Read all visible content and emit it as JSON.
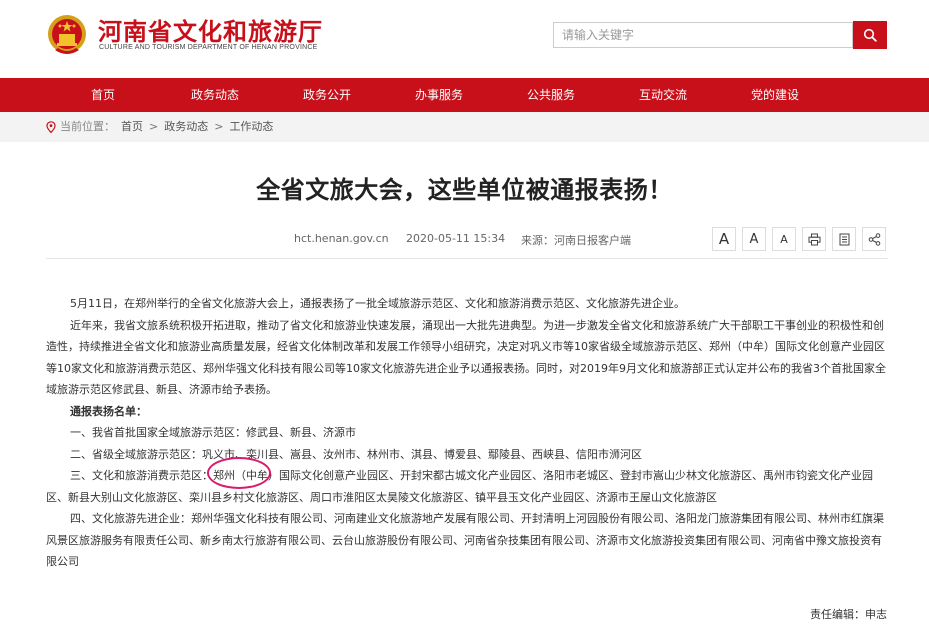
{
  "header": {
    "site_title": "河南省文化和旅游厅",
    "site_subtitle": "CULTURE AND TOURISM DEPARTMENT OF HENAN PROVINCE",
    "search_placeholder": "请输入关键字"
  },
  "nav": {
    "items": [
      "首页",
      "政务动态",
      "政务公开",
      "办事服务",
      "公共服务",
      "互动交流",
      "党的建设"
    ]
  },
  "breadcrumb": {
    "label": "当前位置：",
    "items": [
      "首页",
      "政务动态",
      "工作动态"
    ],
    "separator": ">"
  },
  "article": {
    "title": "全省文旅大会，这些单位被通报表扬！",
    "site": "hct.henan.gov.cn",
    "datetime": "2020-05-11 15:34",
    "source": "来源：河南日报客户端",
    "tools": {
      "font_large": "A",
      "font_medium": "A",
      "font_small": "A"
    },
    "paragraphs": [
      "5月11日，在郑州举行的全省文化旅游大会上，通报表扬了一批全域旅游示范区、文化和旅游消费示范区、文化旅游先进企业。",
      "近年来，我省文旅系统积极开拓进取，推动了省文化和旅游业快速发展，涌现出一大批先进典型。为进一步激发全省文化和旅游系统广大干部职工干事创业的积极性和创造性，持续推进全省文化和旅游业高质量发展，经省文化体制改革和发展工作领导小组研究，决定对巩义市等10家省级全域旅游示范区、郑州（中牟）国际文化创意产业园区等10家文化和旅游消费示范区、郑州华强文化科技有限公司等10家文化旅游先进企业予以通报表扬。同时，对2019年9月文化和旅游部正式认定并公布的我省3个首批国家全域旅游示范区修武县、新县、济源市给予表扬。",
      "通报表扬名单：",
      "一、我省首批国家全域旅游示范区：修武县、新县、济源市",
      "二、省级全域旅游示范区：巩义市、栾川县、嵩县、汝州市、林州市、淇县、博爱县、鄢陵县、西峡县、信阳市浉河区",
      "三、文化和旅游消费示范区：郑州（中牟）国际文化创意产业园区、开封宋都古城文化产业园区、洛阳市老城区、登封市嵩山少林文化旅游区、禹州市钧瓷文化产业园区、新县大别山文化旅游区、栾川县乡村文化旅游区、周口市淮阳区太昊陵文化旅游区、镇平县玉文化产业园区、济源市王屋山文化旅游区",
      "四、文化旅游先进企业：郑州华强文化科技有限公司、河南建业文化旅游地产发展有限公司、开封清明上河园股份有限公司、洛阳龙门旅游集团有限公司、林州市红旗渠风景区旅游服务有限责任公司、新乡南太行旅游有限公司、云台山旅游股份有限公司、河南省杂技集团有限公司、济源市文化旅游投资集团有限公司、河南省中豫文旅投资有限公司"
    ],
    "editor": "责任编辑：申志"
  },
  "colors": {
    "brand_red": "#c8101b",
    "highlight_circle": "#d81b6b"
  }
}
